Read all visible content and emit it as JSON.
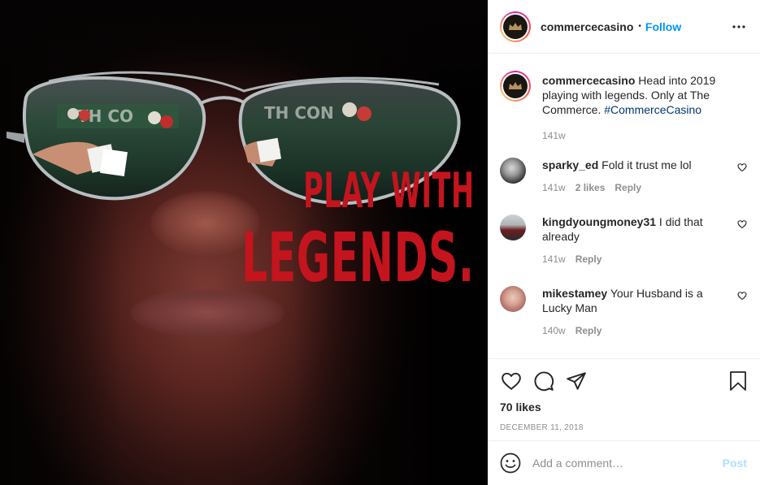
{
  "image": {
    "alt_text_line1": "PLAY WITH",
    "alt_text_line2": "LEGENDS."
  },
  "header": {
    "username": "commercecasino",
    "separator": "•",
    "follow_label": "Follow",
    "more_icon": "more-horizontal-icon"
  },
  "caption": {
    "username": "commercecasino",
    "text": "Head into 2019 playing with legends. Only at The Commerce.",
    "hashtag": "#CommerceCasino",
    "time": "141w"
  },
  "comments": [
    {
      "username": "sparky_ed",
      "text": "Fold it trust me lol",
      "time": "141w",
      "likes": "2 likes",
      "reply": "Reply"
    },
    {
      "username": "kingdyoungmoney31",
      "text": "I did that already",
      "time": "141w",
      "likes": "",
      "reply": "Reply"
    },
    {
      "username": "mikestamey",
      "text": "Your Husband is a Lucky Man",
      "time": "140w",
      "likes": "",
      "reply": "Reply"
    }
  ],
  "actions": {
    "like_icon": "heart-icon",
    "comment_icon": "comment-icon",
    "share_icon": "paper-plane-icon",
    "save_icon": "bookmark-icon",
    "likes_count": "70 likes",
    "date": "December 11, 2018"
  },
  "add_comment": {
    "placeholder": "Add a comment…",
    "post_label": "Post",
    "emoji_icon": "smiley-icon"
  },
  "colors": {
    "accent_blue": "#0095f6",
    "hashtag": "#00376b",
    "post_disabled": "#b2dffc",
    "muted": "#8e8e8e",
    "tagline_red": "#c4141e"
  }
}
